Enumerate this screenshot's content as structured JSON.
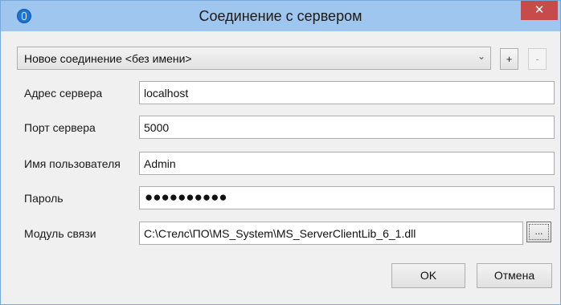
{
  "window": {
    "title": "Соединение с сервером",
    "close_label": "✕"
  },
  "connection": {
    "selected": "Новое соединение <без имени>",
    "add_label": "+",
    "remove_label": "-"
  },
  "fields": {
    "server_address": {
      "label": "Адрес сервера",
      "value": "localhost"
    },
    "server_port": {
      "label": "Порт сервера",
      "value": "5000"
    },
    "username": {
      "label": "Имя пользователя",
      "value": "Admin"
    },
    "password": {
      "label": "Пароль",
      "value": "●●●●●●●●●●"
    },
    "module": {
      "label": "Модуль связи",
      "value": "C:\\Стелс\\ПО\\MS_System\\MS_ServerClientLib_6_1.dll"
    }
  },
  "browse_label": "...",
  "buttons": {
    "ok": "OK",
    "cancel": "Отмена"
  }
}
